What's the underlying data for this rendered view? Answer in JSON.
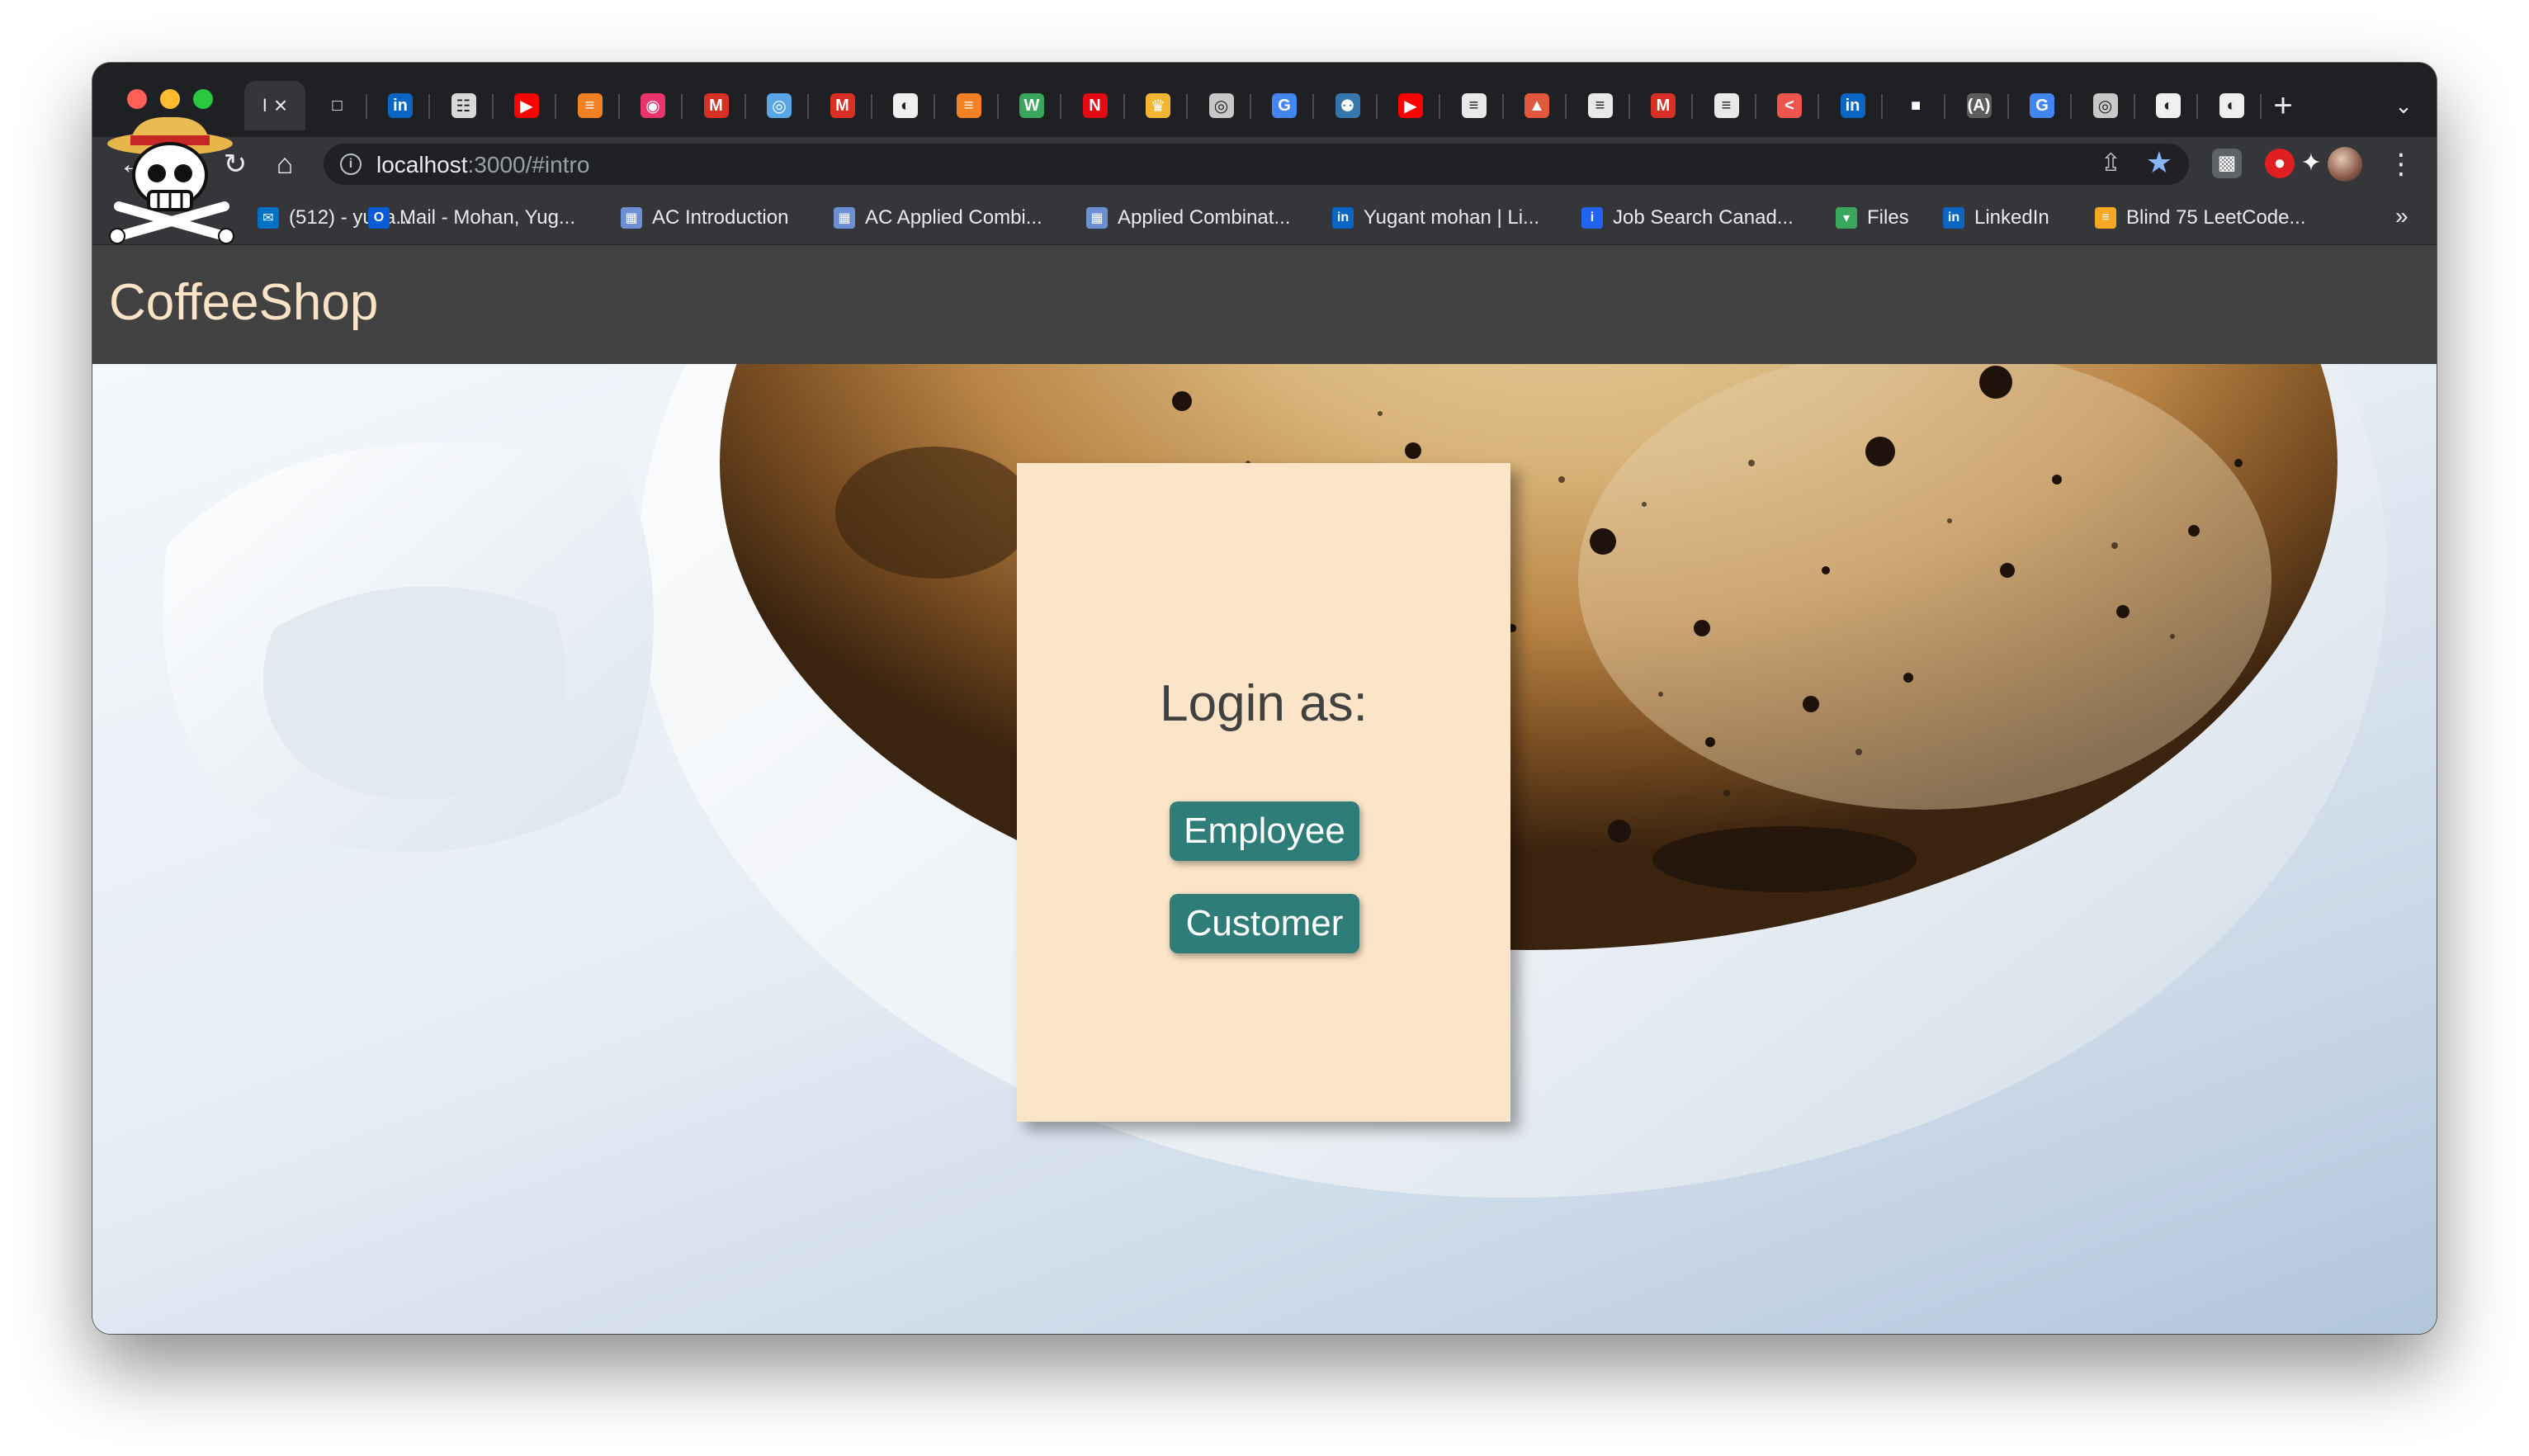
{
  "browser": {
    "tabs": [
      {
        "icon": "app-icon",
        "color": "#35363a",
        "glyph": "I"
      },
      {
        "icon": "square-icon",
        "color": "#1f2023",
        "glyph": "□"
      },
      {
        "icon": "linkedin-icon",
        "color": "#0a66c2",
        "glyph": "in"
      },
      {
        "icon": "owl-icon",
        "color": "#d9d9d9",
        "glyph": "☷"
      },
      {
        "icon": "youtube-icon",
        "color": "#ff0000",
        "glyph": "▶"
      },
      {
        "icon": "stackoverflow-icon",
        "color": "#f48024",
        "glyph": "≡"
      },
      {
        "icon": "podcast-icon",
        "color": "#e8336d",
        "glyph": "◉"
      },
      {
        "icon": "gmail-icon",
        "color": "#d93025",
        "glyph": "M"
      },
      {
        "icon": "compass-icon",
        "color": "#5aa6e6",
        "glyph": "◎"
      },
      {
        "icon": "gmail-icon",
        "color": "#d93025",
        "glyph": "M"
      },
      {
        "icon": "github-icon",
        "color": "#f0f0f0",
        "glyph": "◐"
      },
      {
        "icon": "stackoverflow-icon",
        "color": "#f48024",
        "glyph": "≡"
      },
      {
        "icon": "w-icon",
        "color": "#3aa55c",
        "glyph": "W"
      },
      {
        "icon": "netflix-icon",
        "color": "#e50914",
        "glyph": "N"
      },
      {
        "icon": "crown-icon",
        "color": "#f2b632",
        "glyph": "♛"
      },
      {
        "icon": "chrome-icon",
        "color": "#c8c8c8",
        "glyph": "◎"
      },
      {
        "icon": "google-icon",
        "color": "#4285f4",
        "glyph": "G"
      },
      {
        "icon": "python-icon",
        "color": "#3776ab",
        "glyph": "⚉"
      },
      {
        "icon": "youtube-icon",
        "color": "#ff0000",
        "glyph": "▶"
      },
      {
        "icon": "doc-icon",
        "color": "#e8e8e8",
        "glyph": "≡"
      },
      {
        "icon": "hat-icon",
        "color": "#e2583e",
        "glyph": "▲"
      },
      {
        "icon": "doc-icon",
        "color": "#e8e8e8",
        "glyph": "≡"
      },
      {
        "icon": "gmail-icon",
        "color": "#d93025",
        "glyph": "M"
      },
      {
        "icon": "doc-icon",
        "color": "#e8e8e8",
        "glyph": "≡"
      },
      {
        "icon": "code-icon",
        "color": "#f0544f",
        "glyph": "<"
      },
      {
        "icon": "linkedin-icon",
        "color": "#0a66c2",
        "glyph": "in"
      },
      {
        "icon": "briefcase-icon",
        "color": "#1f2023",
        "glyph": "■"
      },
      {
        "icon": "lambda-icon",
        "color": "#5c5c5c",
        "glyph": "(A)"
      },
      {
        "icon": "google-icon",
        "color": "#4285f4",
        "glyph": "G"
      },
      {
        "icon": "chrome-icon",
        "color": "#c8c8c8",
        "glyph": "◎"
      },
      {
        "icon": "github-icon",
        "color": "#f0f0f0",
        "glyph": "◐"
      },
      {
        "icon": "github-icon",
        "color": "#f0f0f0",
        "glyph": "◐"
      }
    ],
    "active_tab_fragment": "I",
    "new_tab_glyph": "+",
    "tab_search_glyph": "⌄",
    "address": {
      "host": "localhost",
      "rest": ":3000/#intro"
    },
    "bookmarks": [
      {
        "label": "(512) - yuga...",
        "icon": "mail-icon",
        "color": "#0072c6",
        "glyph": "✉"
      },
      {
        "label": "Mail - Mohan, Yug...",
        "icon": "outlook-icon",
        "color": "#0a5bd6",
        "glyph": "O"
      },
      {
        "label": "AC Introduction",
        "icon": "grid-icon",
        "color": "#6d8fd6",
        "glyph": "▦"
      },
      {
        "label": "AC Applied Combi...",
        "icon": "grid-icon",
        "color": "#6d8fd6",
        "glyph": "▦"
      },
      {
        "label": "Applied Combinat...",
        "icon": "grid-icon",
        "color": "#6d8fd6",
        "glyph": "▦"
      },
      {
        "label": "Yugant mohan | Li...",
        "icon": "linkedin-icon",
        "color": "#0a66c2",
        "glyph": "in"
      },
      {
        "label": "Job Search Canad...",
        "icon": "indeed-icon",
        "color": "#2164f3",
        "glyph": "i"
      },
      {
        "label": "Files",
        "icon": "shield-icon",
        "color": "#3aa55c",
        "glyph": "▾"
      },
      {
        "label": "LinkedIn",
        "icon": "linkedin-icon",
        "color": "#0a66c2",
        "glyph": "in"
      },
      {
        "label": "Blind 75 LeetCode...",
        "icon": "leetcode-icon",
        "color": "#f5a623",
        "glyph": "≡"
      }
    ],
    "bookmarks_more": "»"
  },
  "app": {
    "brand": "CoffeeShop",
    "login": {
      "heading": "Login as:",
      "employee_label": "Employee",
      "customer_label": "Customer"
    }
  },
  "colors": {
    "navbar": "#414141",
    "brand_text": "#fae3c6",
    "card_bg": "#fbe4c8",
    "button_bg": "#2e7d78"
  }
}
